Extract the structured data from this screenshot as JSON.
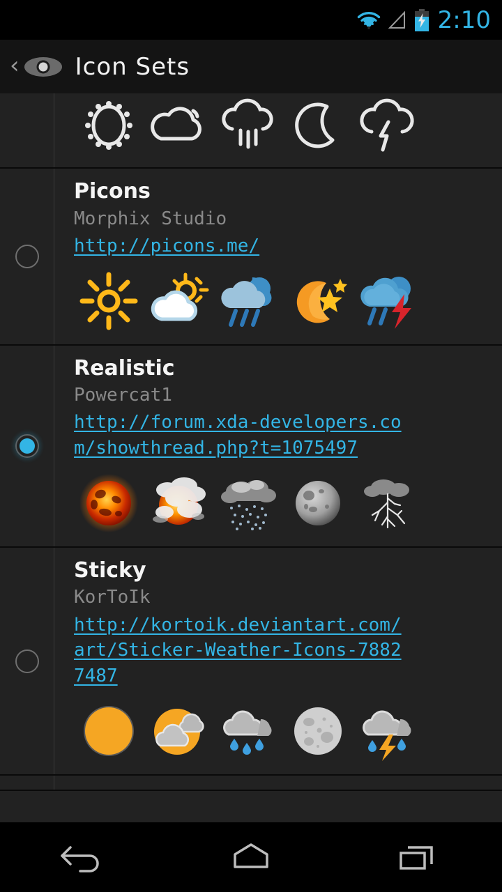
{
  "status_bar": {
    "time": "2:10",
    "icons": [
      "wifi-icon",
      "signal-icon",
      "battery-charging-icon"
    ],
    "accent_color": "#33B5E5"
  },
  "title_bar": {
    "back_label": "‹",
    "app_icon": "eye-icon",
    "title": "Icon Sets"
  },
  "list": {
    "partial_top_set": {
      "name": "",
      "icons": [
        "sun-outline",
        "cloud-outline",
        "rain-outline",
        "moon-outline",
        "thunderstorm-outline"
      ],
      "style": "white-outline"
    },
    "sets": [
      {
        "name": "Picons",
        "author": "Morphix Studio",
        "url": "http://picons.me/",
        "selected": false,
        "style": "flat",
        "icons": [
          "sun",
          "sun-behind-cloud",
          "rain-cloud",
          "crescent-moon-stars",
          "thunderstorm-cloud"
        ]
      },
      {
        "name": "Realistic",
        "author": "Powercat1",
        "url": "http://forum.xda-developers.com/showthread.php?t=1075497",
        "selected": true,
        "style": "photoreal",
        "icons": [
          "fiery-sun",
          "sun-behind-clouds",
          "gray-rain-cloud",
          "gray-moon",
          "lightning-bolt"
        ]
      },
      {
        "name": "Sticky",
        "author": "KorToIk",
        "url": "http://kortoik.deviantart.com/art/Sticker-Weather-Icons-78827487",
        "selected": false,
        "style": "sticker",
        "icons": [
          "orange-sun-disc",
          "sun-behind-gray-clouds",
          "cloud-with-raindrops",
          "cratered-moon",
          "cloud-with-lightning"
        ]
      }
    ]
  },
  "nav_bar": {
    "buttons": [
      "back-nav-icon",
      "home-nav-icon",
      "recents-nav-icon"
    ]
  }
}
